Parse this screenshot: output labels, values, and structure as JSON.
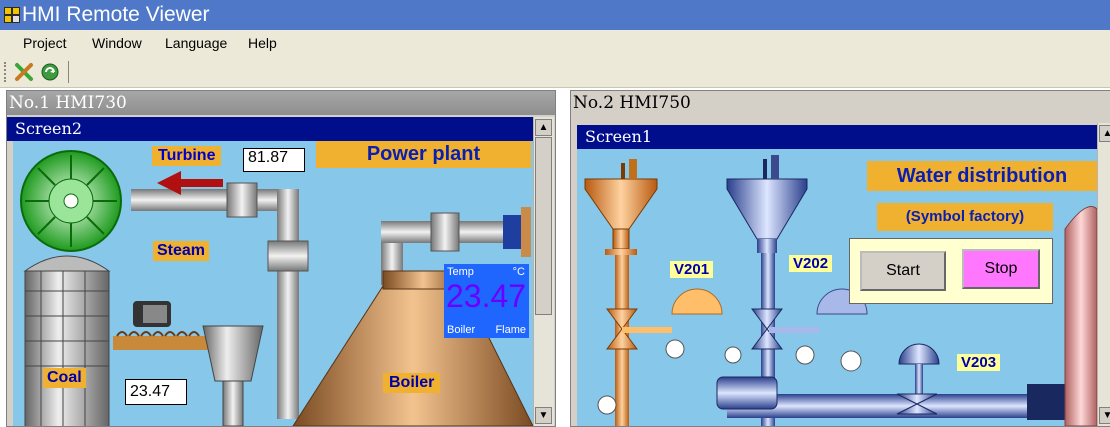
{
  "app": {
    "title": "HMI Remote Viewer"
  },
  "menu": [
    "Project",
    "Window",
    "Language",
    "Help"
  ],
  "windows": [
    {
      "title": "No.1 HMI730",
      "screen": "Screen2",
      "heading": "Power plant",
      "turbine_label": "Turbine",
      "turbine_value": "81.87",
      "steam_label": "Steam",
      "coal_label": "Coal",
      "coal_value": "23.47",
      "boiler_label": "Boiler",
      "temp_panel": {
        "temp": "Temp",
        "unit": "°C",
        "value": "23.47",
        "boiler": "Boiler",
        "flame": "Flame"
      }
    },
    {
      "title": "No.2 HMI750",
      "screen": "Screen1",
      "heading": "Water distribution",
      "subheading": "(Symbol factory)",
      "valves": [
        "V201",
        "V202",
        "V203"
      ],
      "start_label": "Start",
      "stop_label": "Stop"
    }
  ],
  "colors": {
    "titlebar": "#4f79c8",
    "screen_title": "#000e8c",
    "hmi_bg": "#87c8ea",
    "title_box": "#f0b030",
    "stop": "#ff77ff"
  }
}
